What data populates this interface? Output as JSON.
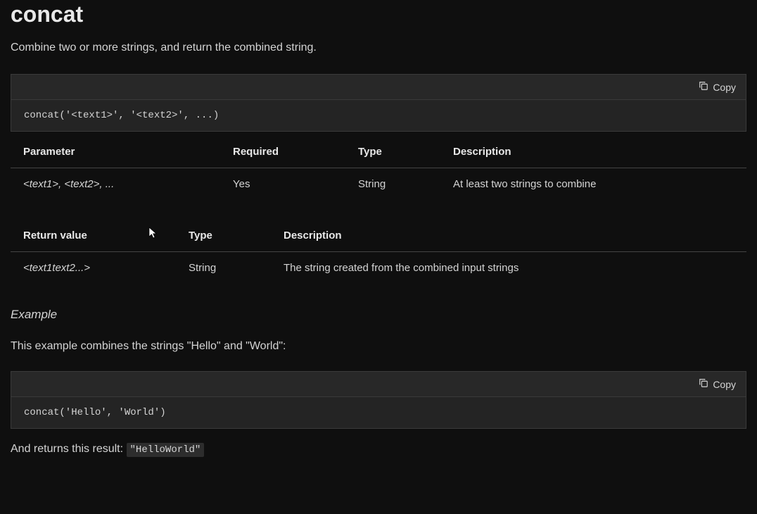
{
  "heading": "concat",
  "intro": "Combine two or more strings, and return the combined string.",
  "copy_label": "Copy",
  "syntax_code": "concat('<text1>', '<text2>', ...)",
  "params_table": {
    "headers": {
      "param": "Parameter",
      "required": "Required",
      "type": "Type",
      "description": "Description"
    },
    "row": {
      "param": "<text1>, <text2>, ...",
      "required": "Yes",
      "type": "String",
      "description": "At least two strings to combine"
    }
  },
  "return_table": {
    "headers": {
      "value": "Return value",
      "type": "Type",
      "description": "Description"
    },
    "row": {
      "value": "<text1text2...>",
      "type": "String",
      "description": "The string created from the combined input strings"
    }
  },
  "example_heading": "Example",
  "example_intro": "This example combines the strings \"Hello\" and \"World\":",
  "example_code": "concat('Hello', 'World')",
  "result_prefix": "And returns this result: ",
  "result_value": "\"HelloWorld\""
}
